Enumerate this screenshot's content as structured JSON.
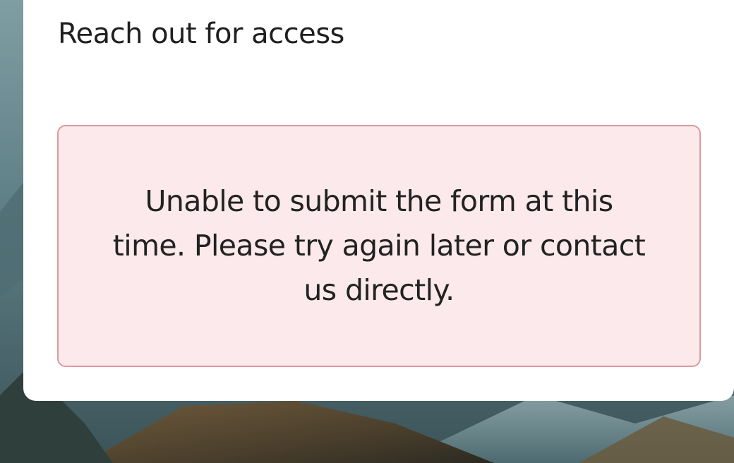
{
  "dialog": {
    "title": "Reach out for access",
    "error_message": "Unable to submit the form at this time. Please try again later or contact us directly."
  },
  "colors": {
    "card_background": "#ffffff",
    "error_background": "#fbe9eb",
    "error_border": "#dc9a9d",
    "text": "#1f1f1f"
  }
}
